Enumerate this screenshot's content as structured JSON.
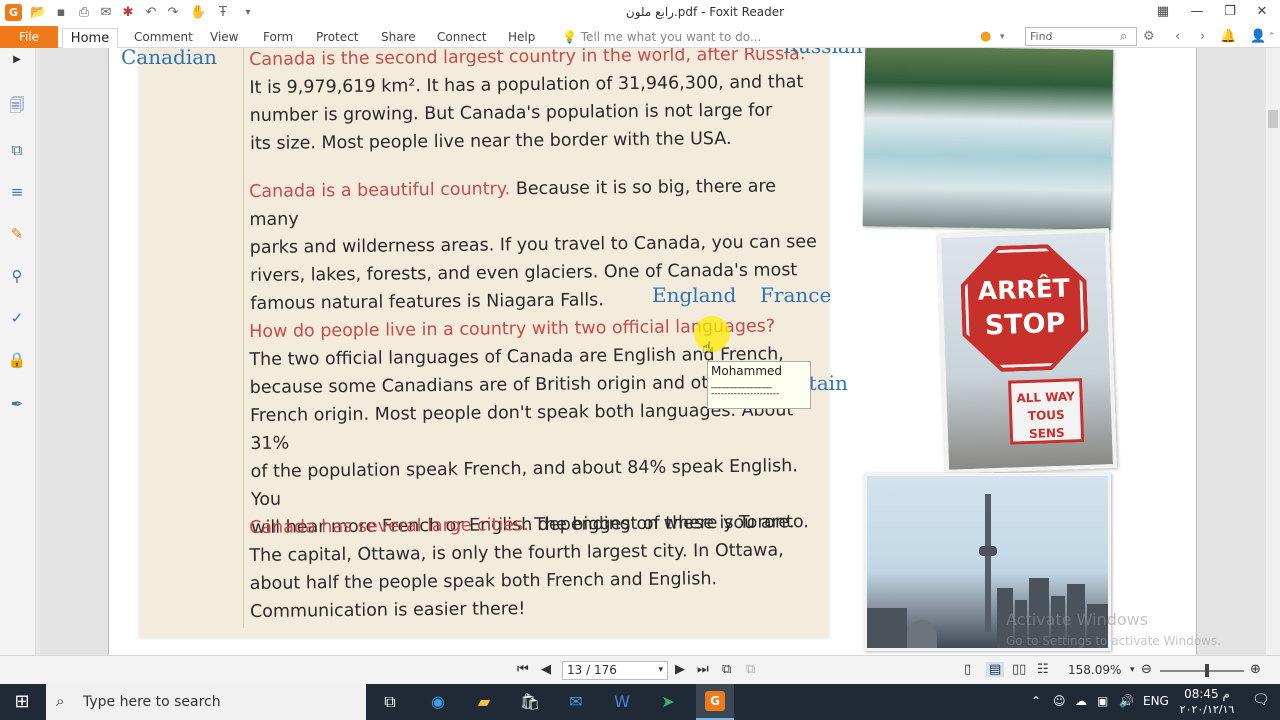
{
  "window": {
    "title": "رابع ملون.pdf - Foxit Reader",
    "logo_letter": "G"
  },
  "ribbon": {
    "file": "File",
    "tabs": [
      "Home",
      "Comment",
      "View",
      "Form",
      "Protect",
      "Share",
      "Connect",
      "Help"
    ],
    "tell_me": "Tell me what you want to do...",
    "find_placeholder": "Find"
  },
  "document": {
    "paragraphs": [
      {
        "red": "Canada is the second largest country in the world, after Russia.",
        "lines": [
          "It is 9,979,619 km². It has a population of 31,946,300, and that",
          "number is growing. But Canada's population is not large for",
          "its size. Most people live near the border with the USA."
        ]
      },
      {
        "red": "Canada is a beautiful country.",
        "lead": " Because it is so big, there are many",
        "lines": [
          "parks and wilderness areas. If you travel to Canada, you can see",
          "rivers, lakes, forests, and even glaciers. One of Canada's most",
          "famous natural features is Niagara Falls."
        ]
      },
      {
        "red": "How do people live in a country with two official languages?",
        "lines": [
          "The two official languages of Canada are English and French,",
          "because some Canadians are of British origin and others are of",
          "French origin. Most people don't speak both languages. About 31%",
          "of the population speak French, and about 84% speak English. You",
          "will hear more French or English depending on where you are."
        ]
      },
      {
        "red": "Canada has several large cities.",
        "lead": " The biggest of these is Toronto.",
        "lines": [
          "The capital, Ottawa, is only the fourth largest city. In Ottawa,",
          "about half the people speak both French and English.",
          "Communication is easier there!"
        ]
      }
    ],
    "annotations": {
      "canadian": "Canadian",
      "russian": "Russian",
      "england": "England",
      "france": "France",
      "britain": "Britain"
    },
    "note": {
      "author": "Mohammed",
      "line1": "_______________",
      "line2": "---------------------"
    },
    "stop_sign": {
      "line1": "ARRÊT",
      "line2": "STOP",
      "allway1": "ALL WAY",
      "allway2": "TOUS SENS"
    },
    "watermark": {
      "title": "Activate Windows",
      "subtitle": "Go to Settings to activate Windows."
    }
  },
  "statusbar": {
    "page": "13 / 176",
    "zoom": "158.09%"
  },
  "taskbar": {
    "search": "Type here to search",
    "lang": "ENG",
    "time": "08:45 م",
    "date": "٢٠٢٠/١٢/١٦"
  }
}
